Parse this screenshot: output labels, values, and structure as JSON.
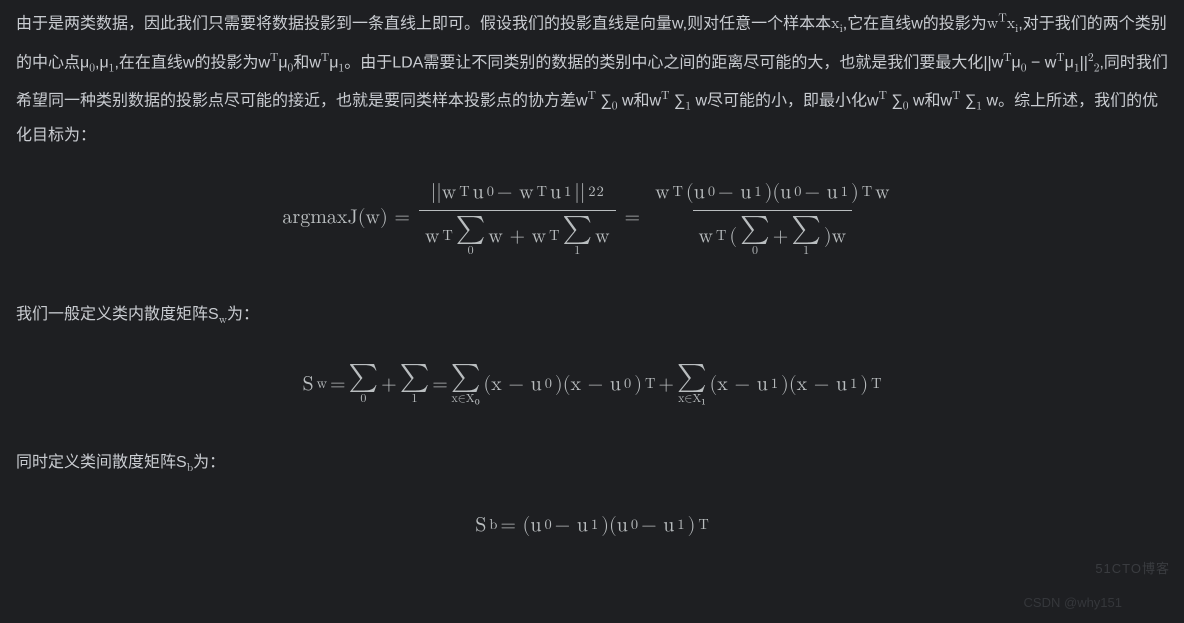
{
  "p1_1": "由于是两类数据，因此我们只需要将数据投影到一条直线上即可。假设我们的投影直线是向量w,则对任意一个样本本",
  "p1_xi": "x",
  "p1_xi_sub": "i",
  "p1_2": ",它在直线w的投影为",
  "p1_wtx": "w",
  "p1_wtx_sup": "T",
  "p1_wtx2": "x",
  "p1_wtx2_sub": "i",
  "p1_3": ",对于我们的两个类别的中心点μ",
  "p1_mu0": "0",
  "p1_4": ",μ",
  "p1_mu1": "1",
  "p1_5": ",在在直线w的投影为w",
  "p1_6": "μ",
  "p1_7": "和w",
  "p1_8": "μ",
  "p1_9": "。由于LDA需要让不同类别的数据的类别中心之间的距离尽可能的大，也就是我们要最大化||w",
  "p1_10": "μ",
  "p1_11": " − w",
  "p1_12": "μ",
  "p1_13": "||",
  "p1_14": ",同时我们希望同一种类别数据的投影点尽可能的接近，也就是要同类样本投影点的协方差w",
  "p1_15": " ∑",
  "p1_16": " w和w",
  "p1_17": " ∑",
  "p1_18": " w尽可能的小，即最小化w",
  "p1_19": " ∑",
  "p1_20": " w和w",
  "p1_21": " ∑",
  "p1_22": " w。综上所述，我们的优化目标为：",
  "eq1_lhs": "argmaxJ(w) =",
  "eq1_num1": "||w",
  "eq1_num1b": "u",
  "eq1_num1c": " − w",
  "eq1_num1d": "u",
  "eq1_num1e": "||",
  "eq1_den1a": "w",
  "eq1_den1b": "w + w",
  "eq1_den1c": "w",
  "eq1_mid": "=",
  "eq1_num2a": "w",
  "eq1_num2b": "(u",
  "eq1_num2c": " − u",
  "eq1_num2d": ")(u",
  "eq1_num2e": " − u",
  "eq1_num2f": ")",
  "eq1_num2g": "w",
  "eq1_den2a": "w",
  "eq1_den2b": "(",
  "eq1_den2c": " + ",
  "eq1_den2d": ")w",
  "p2_1": "我们一般定义类内散度矩阵S",
  "p2_sub": "w",
  "p2_2": "为：",
  "eq2_lhs": "S",
  "eq2_lhs_sub": "w",
  "eq2_eq": " = ",
  "eq2_plus": " + ",
  "eq2_eq2": " = ",
  "eq2_t1a": "(x − u",
  "eq2_t1b": ")(x − u",
  "eq2_t1c": ")",
  "eq2_plus2": " + ",
  "eq2_t2a": "(x − u",
  "eq2_t2b": ")(x − u",
  "eq2_t2c": ")",
  "p3_1": "同时定义类间散度矩阵S",
  "p3_sub": "b",
  "p3_2": "为：",
  "eq3_lhs": "S",
  "eq3_lhs_sub": "b",
  "eq3_rhs": " = (u",
  "eq3_mid": " − u",
  "eq3_mid2": ")(u",
  "eq3_mid3": " − u",
  "eq3_end": ")",
  "s0": "0",
  "s1": "1",
  "s2": "2",
  "sT": "T",
  "sum_sub_x0": "x∈X₀",
  "sum_sub_x1": "x∈X₁",
  "sigma": "∑",
  "wm1": "51CTO博客",
  "wm2": "CSDN @why151"
}
